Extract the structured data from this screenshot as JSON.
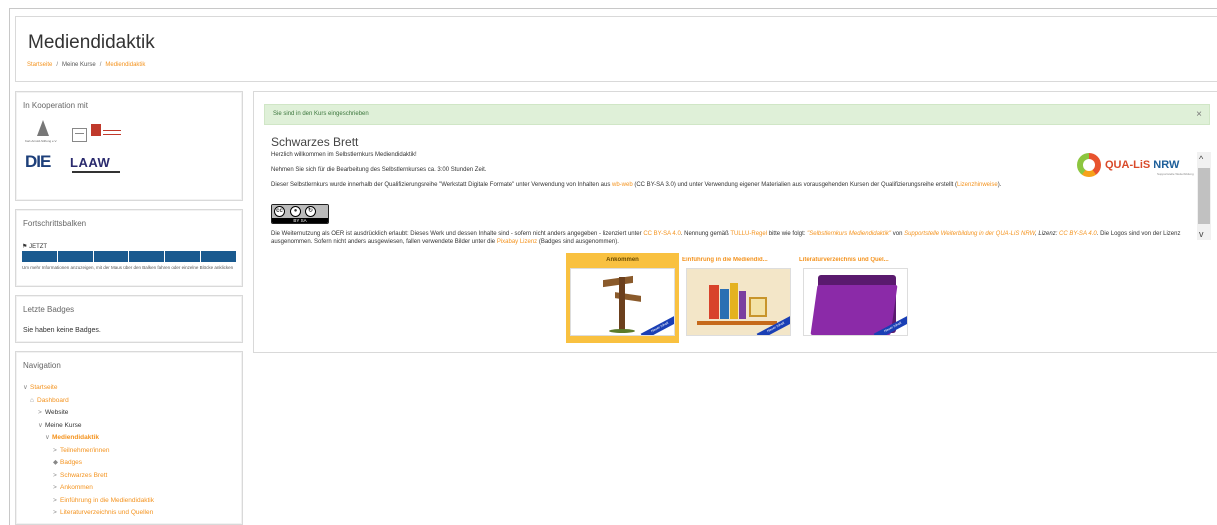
{
  "header": {
    "title": "Mediendidaktik",
    "breadcrumb": [
      "Startseite",
      "Meine Kurse",
      "Mediendidaktik"
    ]
  },
  "cooperation": {
    "title": "In Kooperation mit",
    "logos": {
      "kas": "Karl-Arnold-Stiftung e.V.",
      "die": "DIE",
      "laaw": "LAAW"
    }
  },
  "progress": {
    "title": "Fortschrittsbalken",
    "now_label": "JETZT",
    "segments": 6,
    "note": "Um mehr Informationen anzuzeigen, mit der Maus über den Balken fahren oder einzelne Blöcke anklicken"
  },
  "badges": {
    "title": "Letzte Badges",
    "text": "Sie haben keine Badges."
  },
  "navigation": {
    "title": "Navigation",
    "items": [
      {
        "label": "Startseite",
        "caret": "∨"
      },
      {
        "label": "Dashboard",
        "caret": "⌂"
      },
      {
        "label": "Website",
        "caret": ">"
      },
      {
        "label": "Meine Kurse",
        "caret": "∨"
      },
      {
        "label": "Mediendidaktik",
        "caret": "∨"
      },
      {
        "label": "Teilnehmer/innen",
        "caret": ">"
      },
      {
        "label": "Badges",
        "caret": "◆"
      },
      {
        "label": "Schwarzes Brett",
        "caret": ">"
      },
      {
        "label": "Ankommen",
        "caret": ">"
      },
      {
        "label": "Einführung in die Mediendidaktik",
        "caret": ">"
      },
      {
        "label": "Literaturverzeichnis und Quellen",
        "caret": ">"
      }
    ]
  },
  "alert": {
    "text": "Sie sind in den Kurs eingeschrieben",
    "close": "×"
  },
  "section": {
    "title": "Schwarzes Brett",
    "p1": "Herzlich willkommen im Selbstlernkurs Mediendidaktik!",
    "p2": "Nehmen Sie sich für die Bearbeitung des Selbstlernkurses ca. 3:00 Stunden Zeit.",
    "p3_a": "Dieser Selbstlernkurs wurde innerhalb der Qualifizierungsreihe \"Werkstatt Digitale Formate\" unter Verwendung von Inhalten aus ",
    "p3_link1": "wb-web",
    "p3_b": " (CC BY-SA 3.0) und unter Verwendung eigener Materialien aus vorausgehenden Kursen der Qualifizierungsreihe erstellt (",
    "p3_link2": "Lizenzhinweise",
    "p3_c": ").",
    "p4_a": "Die Weiternutzung als OER ist ausdrücklich erlaubt: Dieses Werk und dessen Inhalte sind - sofern nicht anders angegeben - lizenziert unter ",
    "p4_link1": "CC BY-SA 4.0",
    "p4_b": ". Nennung gemäß ",
    "p4_link2": "TULLU-Regel",
    "p4_c": " bitte wie folgt: ",
    "p4_link3": "\"Selbstlernkurs Mediendidaktik\"",
    "p4_d": " von ",
    "p4_link4": "Supportstelle Weiterbildung in der QUA-LiS NRW",
    "p4_e": ", Lizenz: ",
    "p4_link5": "CC BY-SA 4.0",
    "p4_f": ". Die Logos sind von der Lizenz ausgenommen. Sofern nicht anders ausgewiesen, fallen verwendete Bilder unter die ",
    "p4_link6": "Pixabay Lizenz",
    "p4_g": " (Badges sind ausgenommen)."
  },
  "cc_badge": {
    "cc": "cc",
    "by": "BY",
    "sa": "SA"
  },
  "qualis": {
    "name_a": "QUA-LiS ",
    "name_b": "NRW",
    "sub": "Supportstelle Weiterbildung"
  },
  "tiles": [
    {
      "title": "Ankommen",
      "ribbon": "Neuer Inhalt"
    },
    {
      "title": "Einführung in die Mediendid...",
      "ribbon": "Neuer Inhalt"
    },
    {
      "title": "Literaturverzeichnis und Quel...",
      "ribbon": "Neuer Inhalt"
    }
  ],
  "colors": {
    "accent": "#f4931e",
    "progress": "#1a5a8f",
    "alert_bg": "#dff0d8",
    "alert_text": "#3c763d"
  },
  "icons": {
    "scroll_up": "^",
    "scroll_down": "v",
    "flag": "⚑"
  }
}
